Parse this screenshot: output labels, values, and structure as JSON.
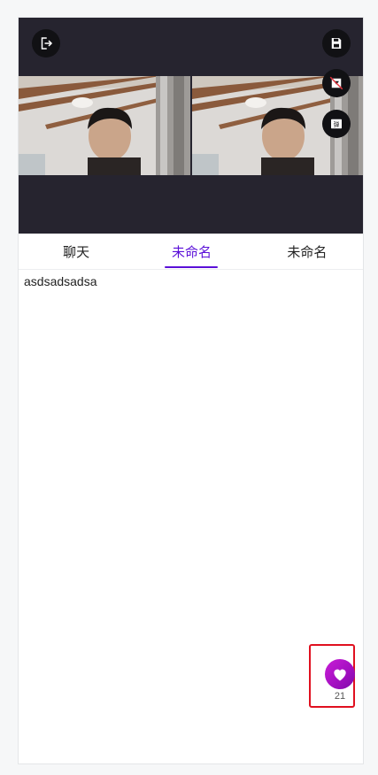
{
  "tabs": [
    {
      "label": "聊天",
      "active": false
    },
    {
      "label": "未命名",
      "active": true
    },
    {
      "label": "未命名",
      "active": false
    }
  ],
  "content": {
    "text": "asdsadsadsa"
  },
  "like": {
    "count": "21",
    "color": "#b515c9"
  },
  "controls": {
    "exit_icon": "exit-icon",
    "save_icon": "save-icon",
    "camera_off_icon": "camera-off-icon",
    "danmaku_icon": "danmaku-icon",
    "danmaku_glyph": "弹"
  },
  "colors": {
    "accent": "#5a0fd8",
    "video_bg": "#26242f",
    "highlight_border": "#e0101f"
  }
}
